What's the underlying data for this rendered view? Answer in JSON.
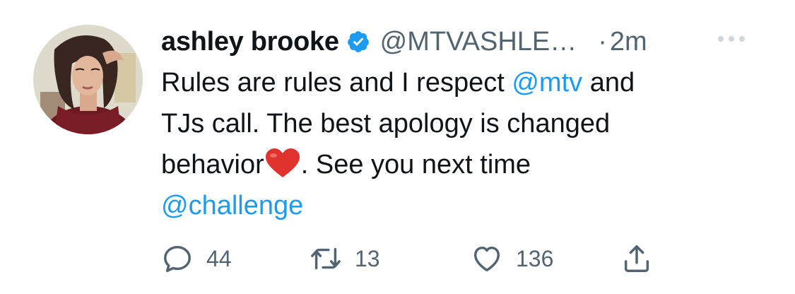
{
  "tweet": {
    "author": {
      "name": "ashley brooke",
      "handle": "@MTVASHLE…",
      "verified": true
    },
    "separator": "·",
    "time": "2m",
    "body": {
      "line1_text": "Rules are rules and I respect ",
      "line1_mention": "@mtv",
      "line1_tail": " and",
      "line2": "TJs call.  The best apology is changed",
      "line3_pre": "behavior",
      "line3_emoji": "red-heart-emoji",
      "line3_post": ". See you next time",
      "line4_mention": "@challenge"
    },
    "actions": {
      "reply_count": "44",
      "retweet_count": "13",
      "like_count": "136"
    }
  },
  "colors": {
    "link": "#1d9bf0",
    "secondary_text": "#536471",
    "verified_badge": "#1d9bf0",
    "heart_emoji": "#e0322f"
  },
  "icons": [
    "reply-icon",
    "retweet-icon",
    "like-icon",
    "share-icon",
    "more-icon",
    "verified-badge-icon"
  ]
}
